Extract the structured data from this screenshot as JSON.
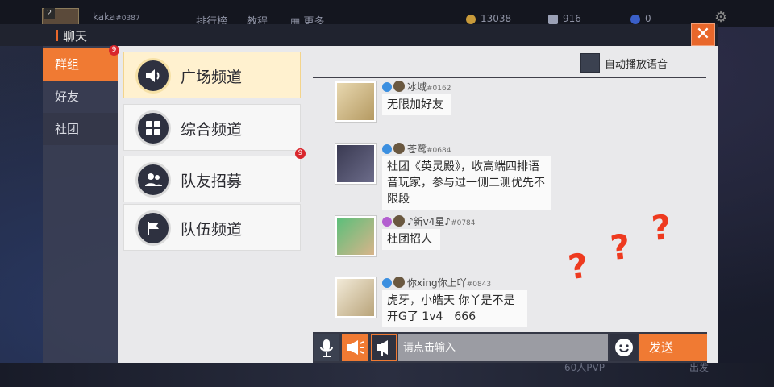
{
  "topbar": {
    "avatar_level": "2",
    "username": "kaka",
    "user_tag": "#0387",
    "nav": [
      "排行榜",
      "教程",
      "更多"
    ],
    "gold": "13038",
    "gems": "916",
    "tokens": "0"
  },
  "chat_header": {
    "title": "聊天",
    "close": "✕"
  },
  "side_tabs": [
    {
      "label": "群组",
      "badge": "9"
    },
    {
      "label": "好友"
    },
    {
      "label": "社团"
    }
  ],
  "channels": [
    {
      "label": "广场频道",
      "icon": "speaker-icon"
    },
    {
      "label": "综合频道",
      "icon": "grid-icon"
    },
    {
      "label": "队友招募",
      "icon": "team-icon",
      "badge": "9"
    },
    {
      "label": "队伍频道",
      "icon": "flag-icon"
    }
  ],
  "autoplay": {
    "label": "自动播放语音",
    "checked": false
  },
  "messages": [
    {
      "name": "冰域",
      "tag": "#0162",
      "text": "无限加好友",
      "gender": "male"
    },
    {
      "name": "苍鹭",
      "tag": "#0684",
      "text": "社团《英灵殿》，收高端四排语音玩家，参与过一侧二测优先不限段",
      "gender": "male"
    },
    {
      "name": "♪新v4星♪",
      "tag": "#0784",
      "text": "杜团招人",
      "gender": "female"
    },
    {
      "name": "你xing你上吖",
      "tag": "#0843",
      "text": "虎牙，小皓天 你丫是不是开G了 1v4　666",
      "gender": "male"
    }
  ],
  "input": {
    "placeholder": "请点击输入",
    "send_label": "发送"
  },
  "annotations": [
    "?",
    "?",
    "?"
  ],
  "background": {
    "mode": "60人PVP",
    "start": "出发"
  },
  "colors": {
    "accent": "#f07a33",
    "badge": "#d9262c",
    "annotation": "#ee3a1f"
  }
}
